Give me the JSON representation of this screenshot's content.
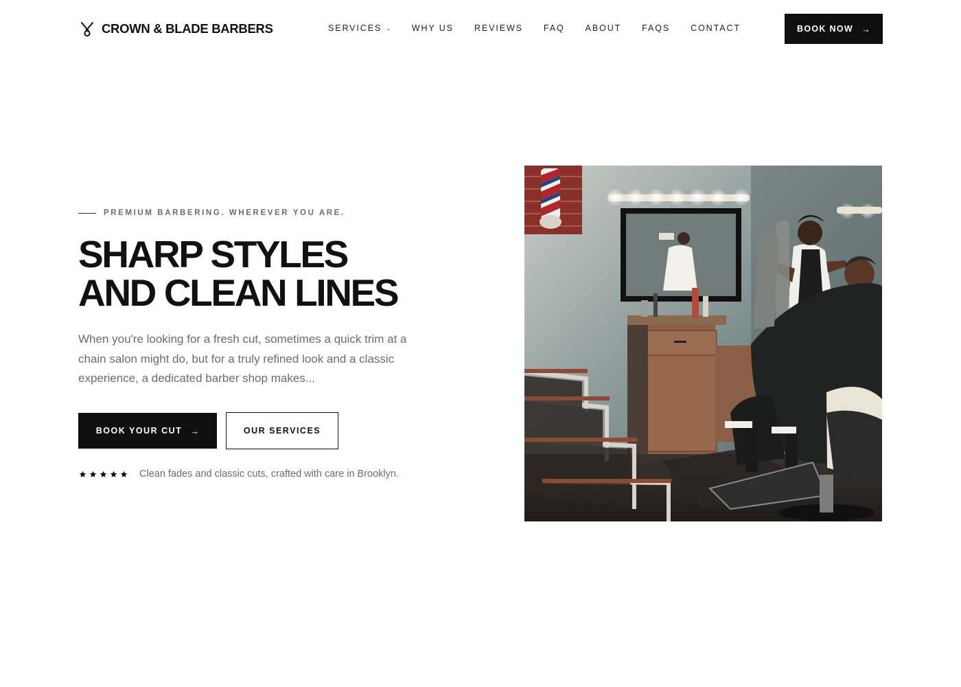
{
  "brand": {
    "name": "CROWN & BLADE BARBERS",
    "logo_icon": "scissors-icon"
  },
  "nav": {
    "items": [
      {
        "label": "SERVICES",
        "has_dropdown": true
      },
      {
        "label": "WHY US"
      },
      {
        "label": "REVIEWS"
      },
      {
        "label": "FAQ"
      },
      {
        "label": "ABOUT"
      },
      {
        "label": "FAQS"
      },
      {
        "label": "CONTACT"
      }
    ],
    "dropdown_icon": "chevron-down-icon",
    "cta": {
      "label": "BOOK NOW",
      "icon": "arrow-right-icon"
    }
  },
  "hero": {
    "eyebrow": "PREMIUM BARBERING. WHEREVER YOU ARE.",
    "headline_line1": "SHARP STYLES",
    "headline_line2": "AND CLEAN LINES",
    "lede": "When you're looking for a fresh cut, sometimes a quick trim at a chain salon might do, but for a truly refined look and a classic experience, a dedicated barber shop makes...",
    "primary_cta": {
      "label": "BOOK YOUR CUT",
      "icon": "arrow-right-icon"
    },
    "secondary_cta": {
      "label": "OUR SERVICES"
    },
    "rating": {
      "stars": 5,
      "star_icon": "star-icon",
      "note": "Clean fades and classic cuts, crafted with care in Brooklyn."
    }
  },
  "colors": {
    "background": "#ffffff",
    "ink": "#0f0f10",
    "muted_text": "#6b6b72",
    "eyebrow_text": "#6b6b6f"
  }
}
